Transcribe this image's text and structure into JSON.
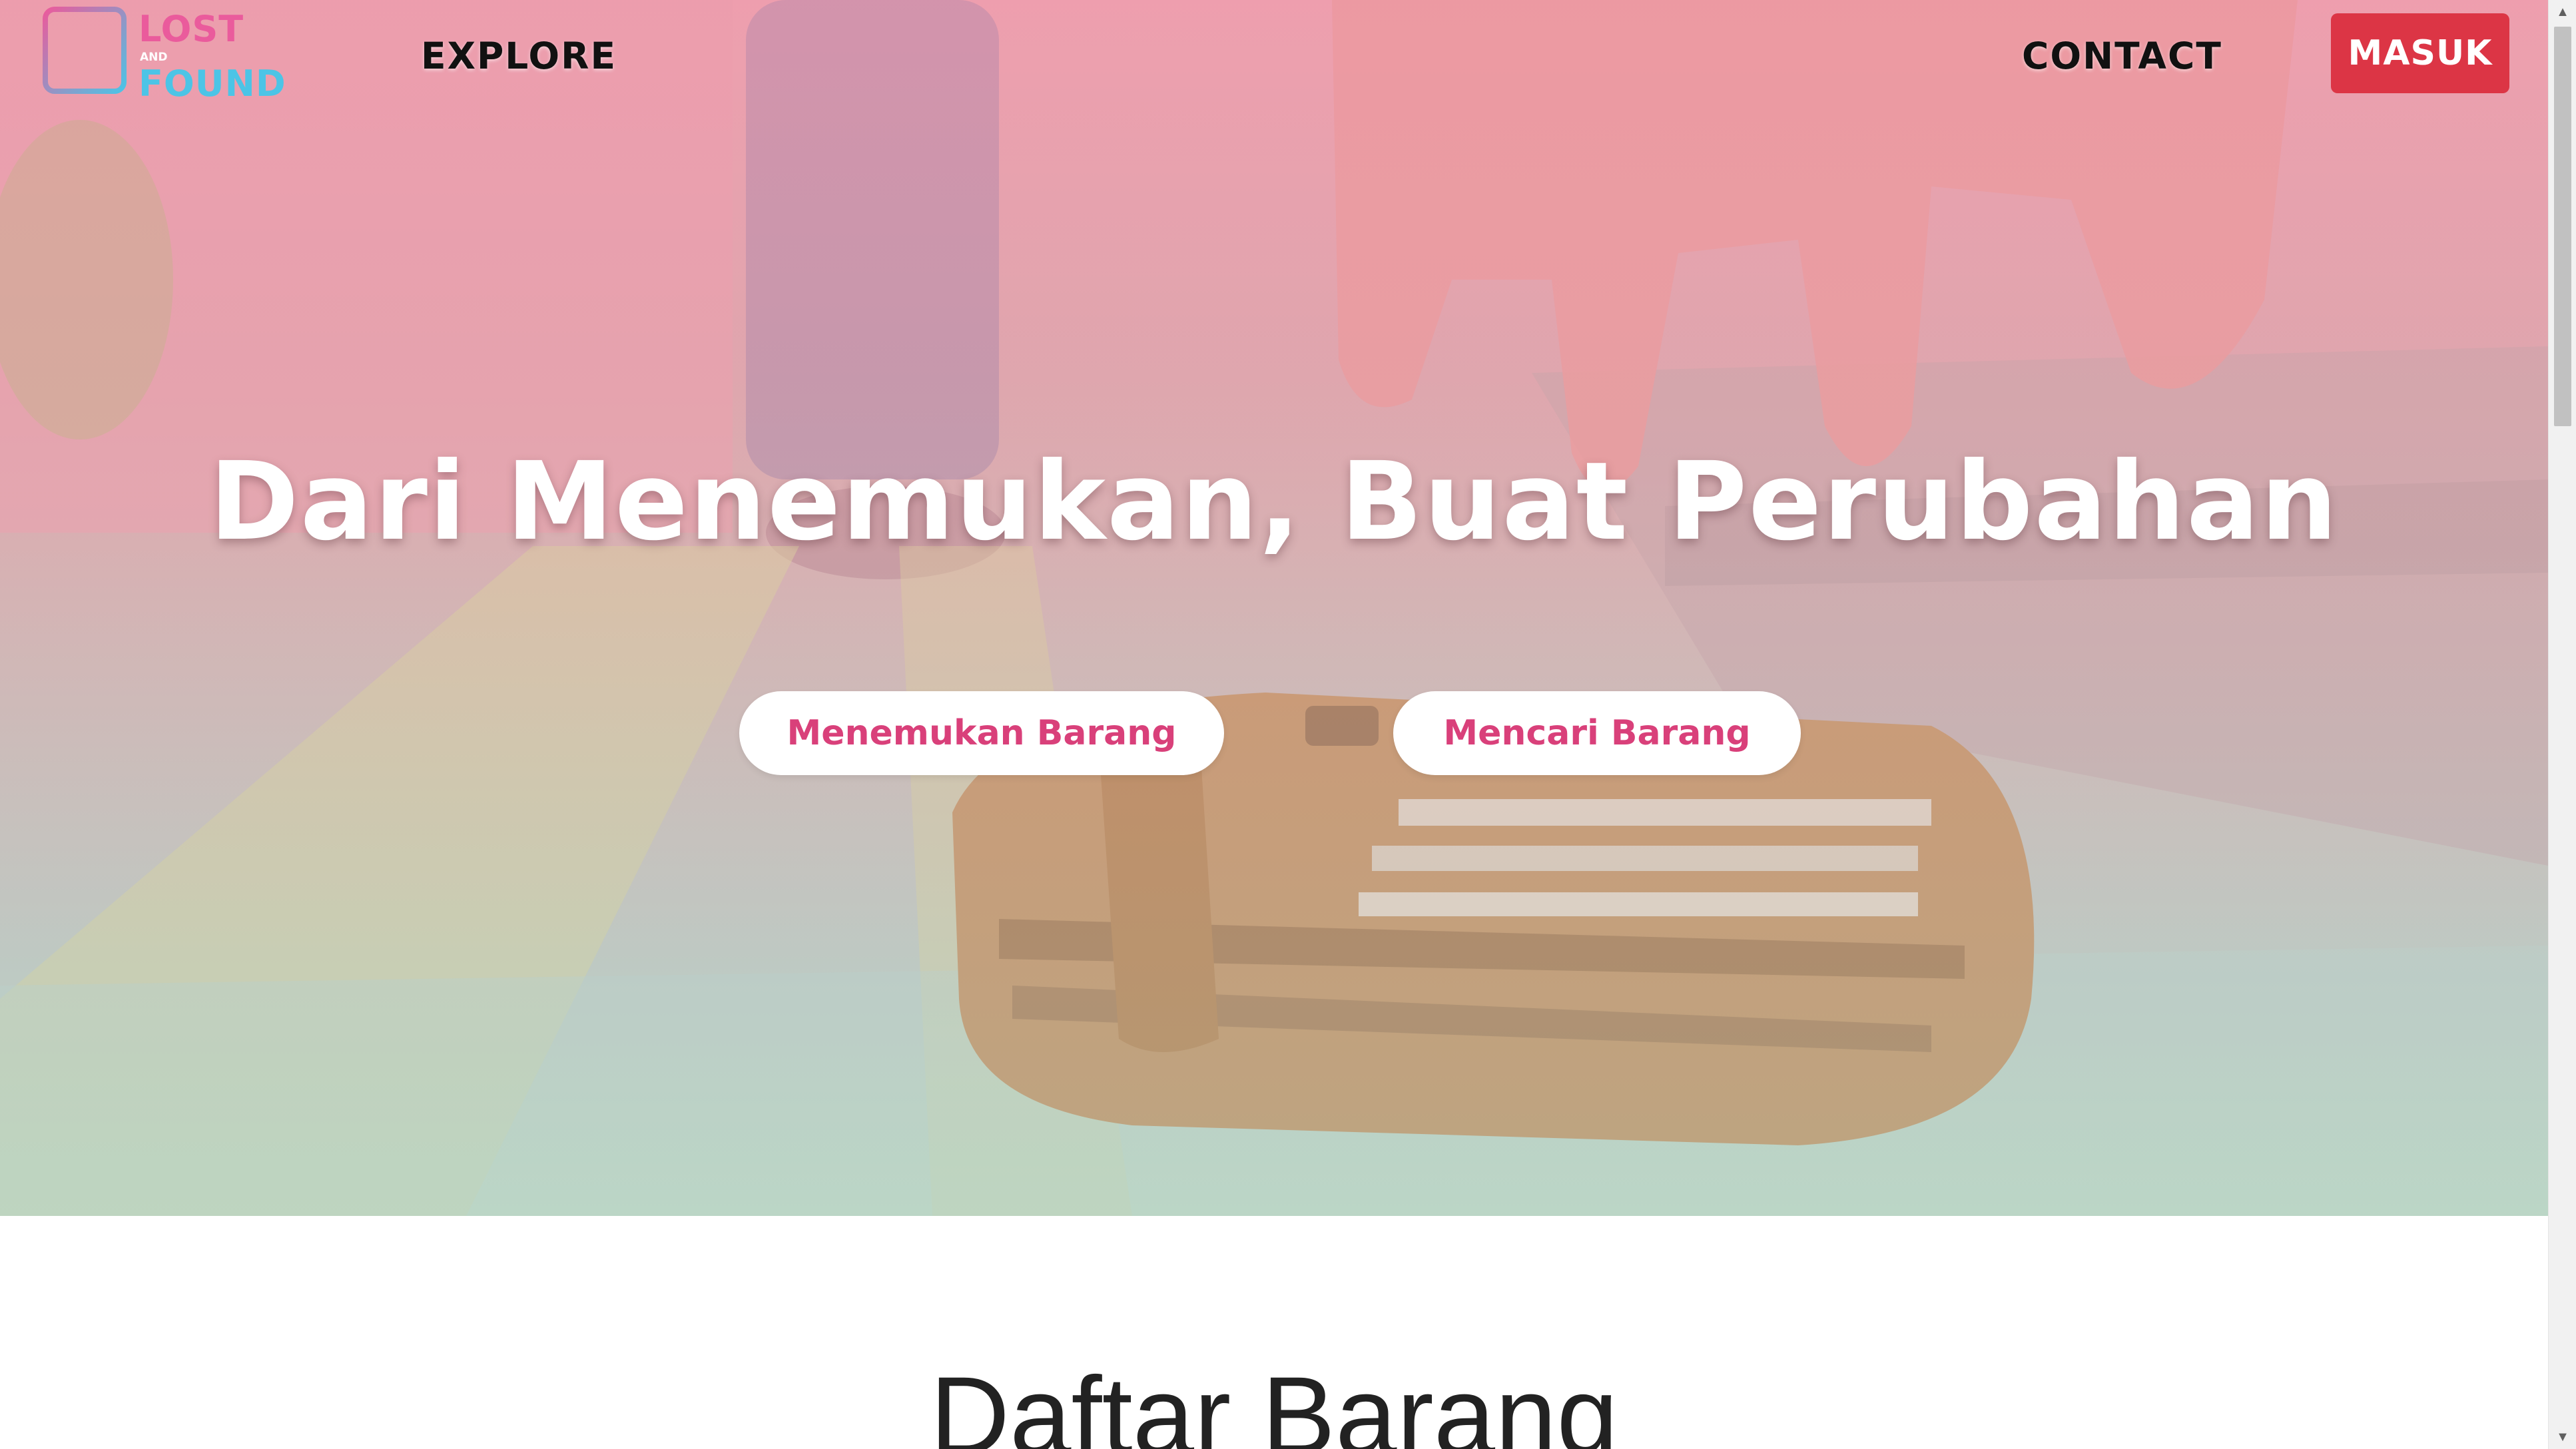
{
  "nav": {
    "logo": {
      "lost": "LOST",
      "and": "AND",
      "found": "FOUND"
    },
    "links": {
      "explore": "EXPLORE",
      "contact": "CONTACT"
    },
    "login_button": "MASUK"
  },
  "hero": {
    "title": "Dari Menemukan, Buat Perubahan",
    "buttons": {
      "found_item": "Menemukan Barang",
      "search_item": "Mencari Barang"
    }
  },
  "section": {
    "title": "Daftar Barang"
  },
  "scrollbar": {
    "up_icon": "▲",
    "down_icon": "▼"
  },
  "colors": {
    "brand_pink": "#ea5b9c",
    "brand_blue": "#4cc4e6",
    "login_red": "#dc3545",
    "button_text_pink": "#d9407a"
  }
}
